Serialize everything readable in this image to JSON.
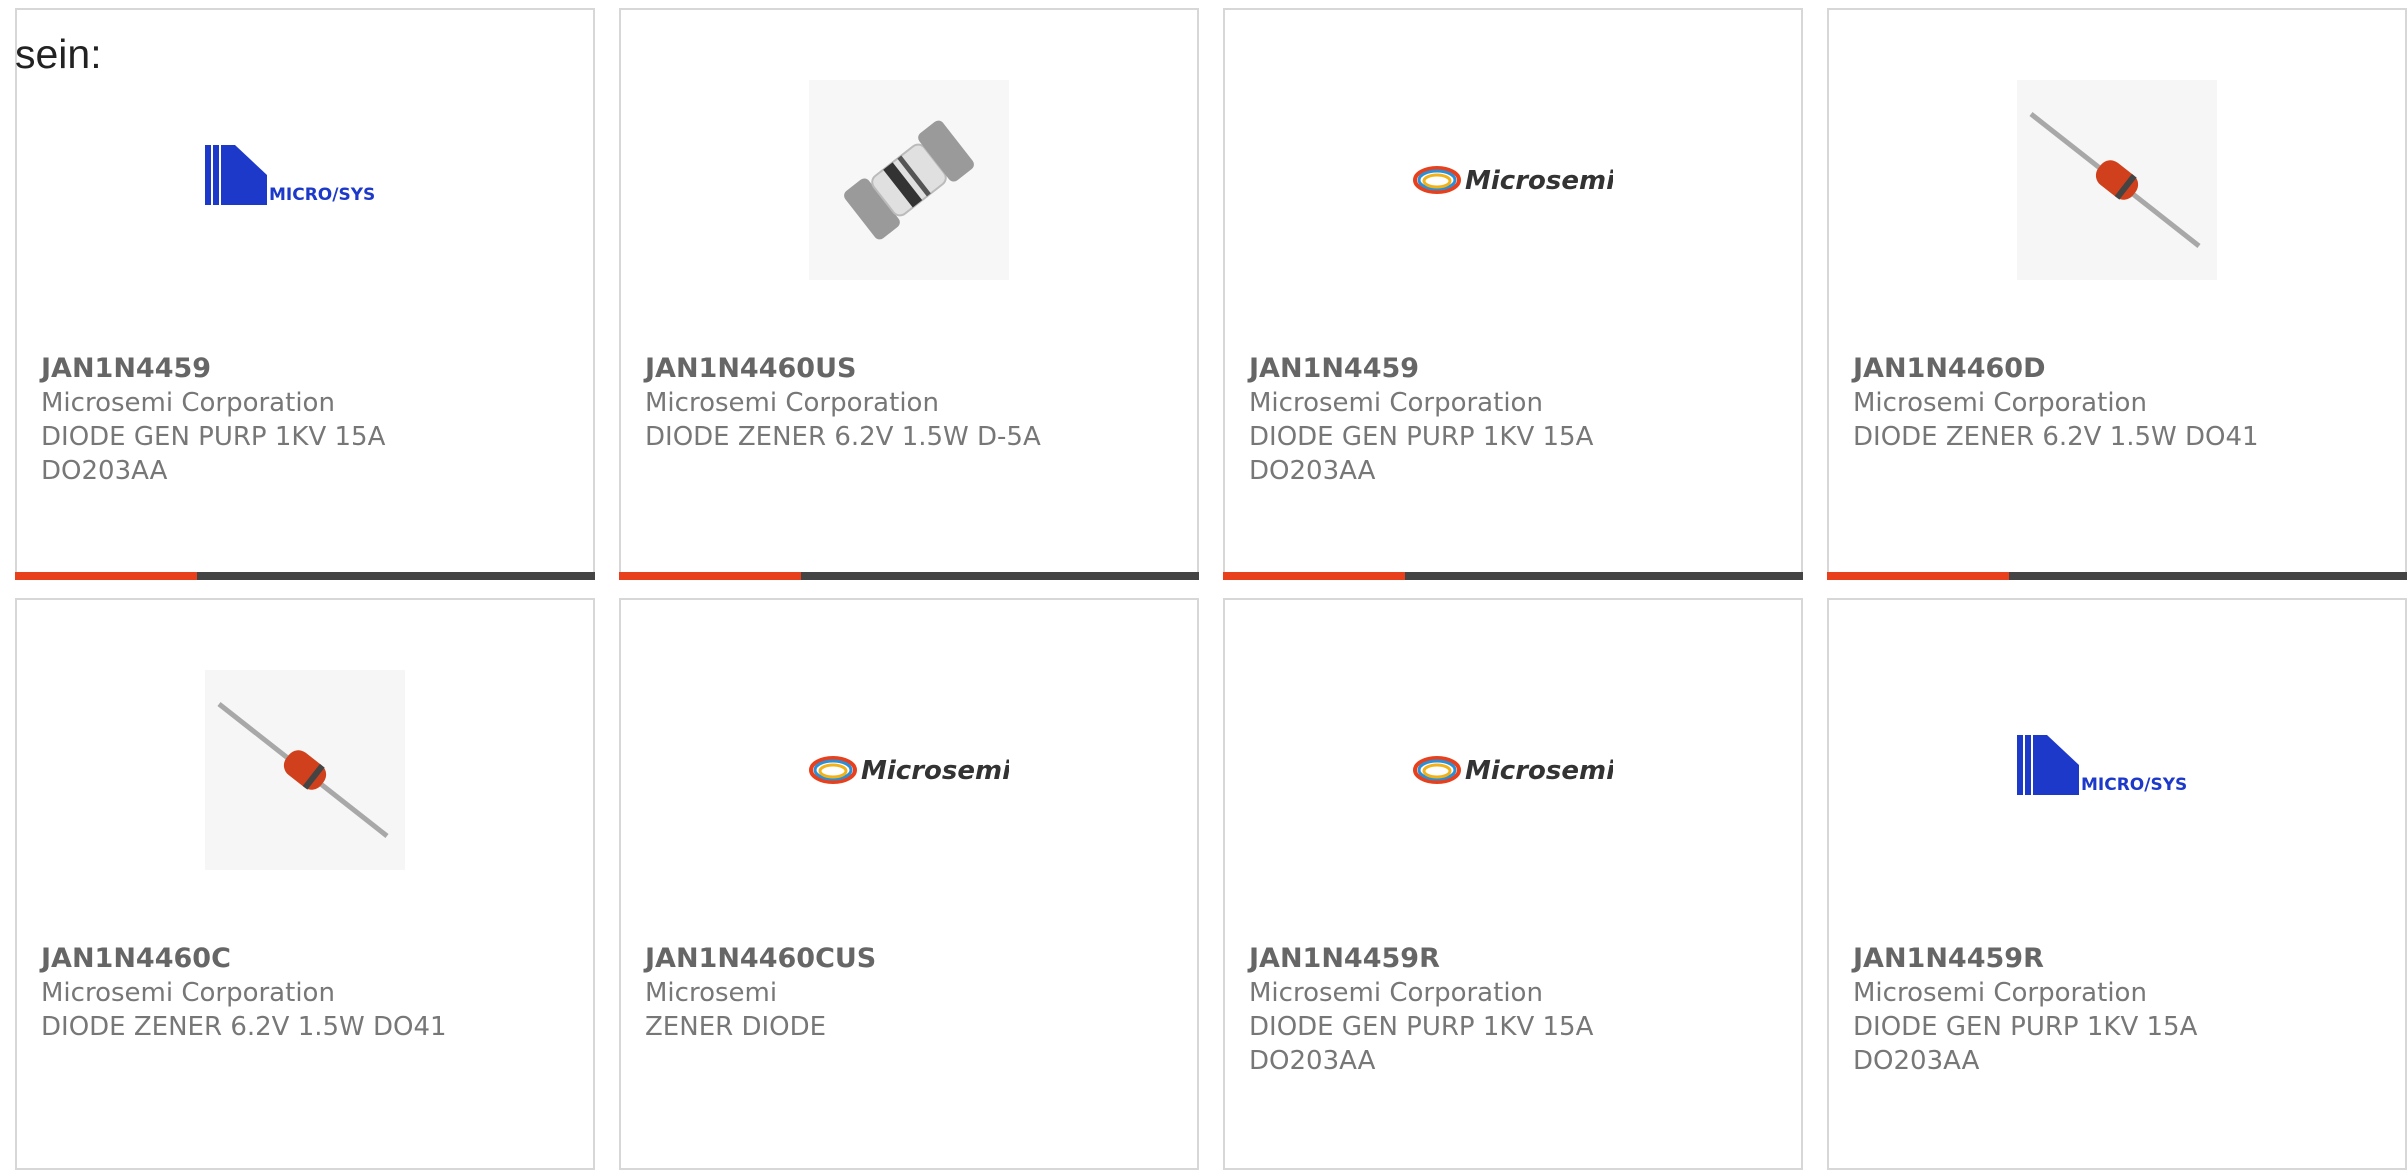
{
  "intro_text": "sein:",
  "accent_color": "#e8401c",
  "bar_color": "#444444",
  "products": [
    {
      "part": "JAN1N4459",
      "manufacturer": "Microsemi Corporation",
      "description": "DIODE GEN PURP 1KV 15A DO203AA",
      "image": "microsys-logo"
    },
    {
      "part": "JAN1N4460US",
      "manufacturer": "Microsemi Corporation",
      "description": "DIODE ZENER 6.2V 1.5W D-5A",
      "image": "smd-diode-photo"
    },
    {
      "part": "JAN1N4459",
      "manufacturer": "Microsemi Corporation",
      "description": "DIODE GEN PURP 1KV 15A DO203AA",
      "image": "microsemi-logo"
    },
    {
      "part": "JAN1N4460D",
      "manufacturer": "Microsemi Corporation",
      "description": "DIODE ZENER 6.2V 1.5W DO41",
      "image": "axial-diode-photo"
    },
    {
      "part": "JAN1N4460C",
      "manufacturer": "Microsemi Corporation",
      "description": "DIODE ZENER 6.2V 1.5W DO41",
      "image": "axial-diode-photo"
    },
    {
      "part": "JAN1N4460CUS",
      "manufacturer": "Microsemi",
      "description": "ZENER DIODE",
      "image": "microsemi-logo"
    },
    {
      "part": "JAN1N4459R",
      "manufacturer": "Microsemi Corporation",
      "description": "DIODE GEN PURP 1KV 15A DO203AA",
      "image": "microsemi-logo"
    },
    {
      "part": "JAN1N4459R",
      "manufacturer": "Microsemi Corporation",
      "description": "DIODE GEN PURP 1KV 15A DO203AA",
      "image": "microsys-logo"
    }
  ]
}
